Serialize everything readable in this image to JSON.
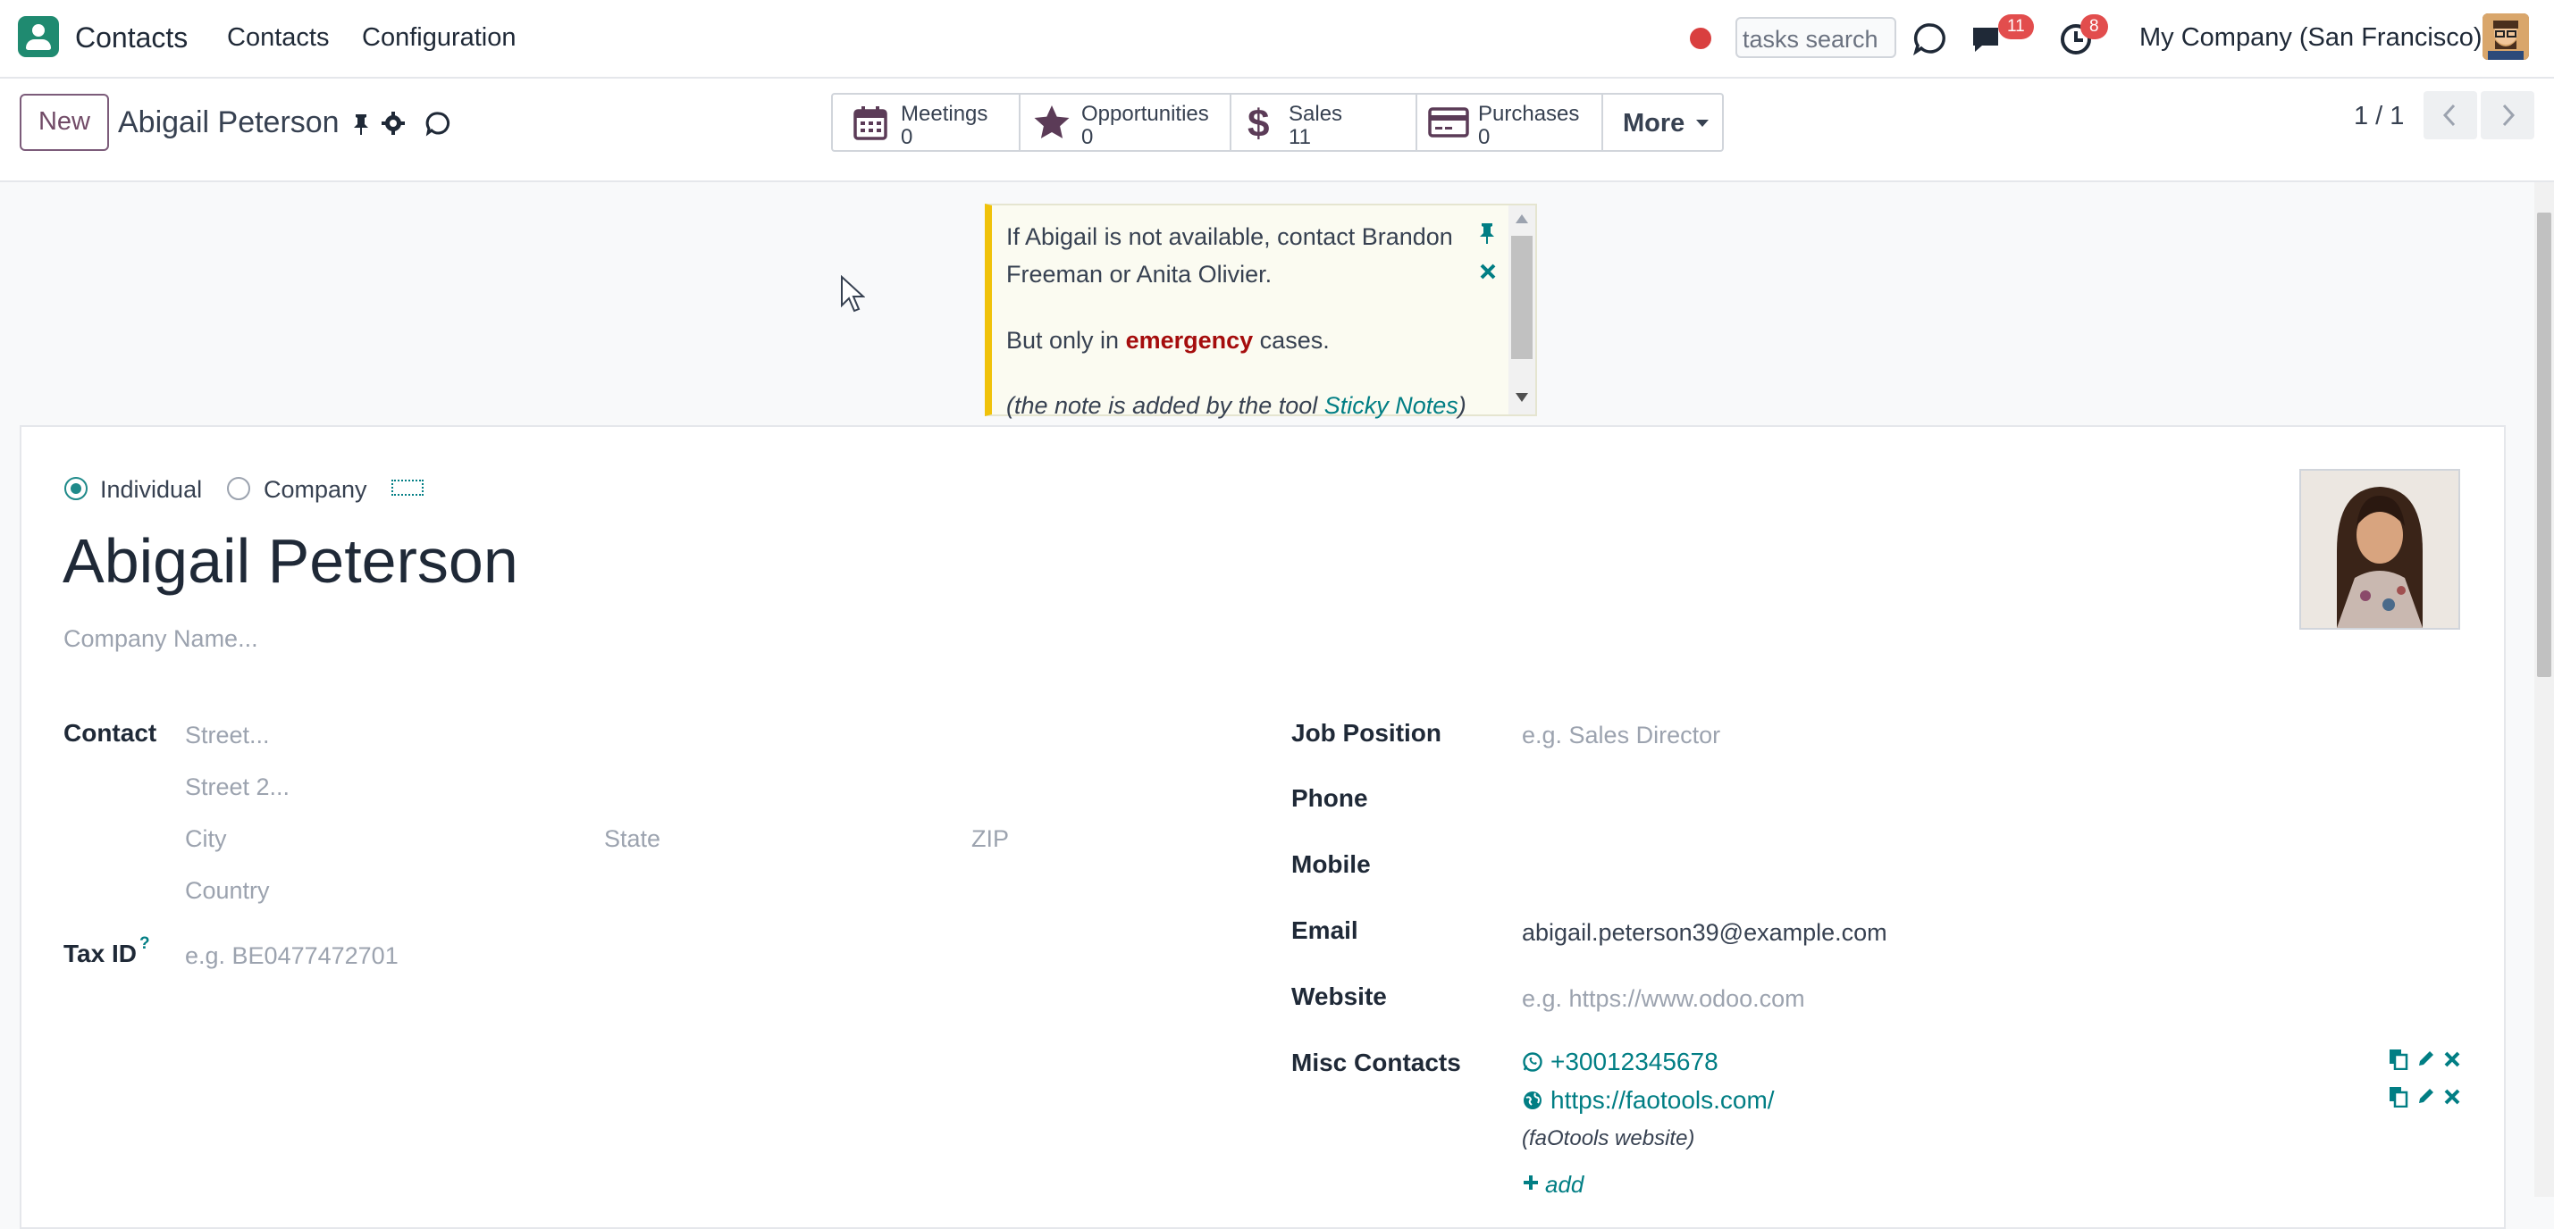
{
  "topnav": {
    "app_name": "Contacts",
    "menu": [
      "Contacts",
      "Configuration"
    ],
    "tasks_search_placeholder": "tasks search",
    "messages_badge": "11",
    "activities_badge": "8",
    "company": "My Company (San Francisco)"
  },
  "control_panel": {
    "new_label": "New",
    "record_name": "Abigail Peterson",
    "smart_buttons": [
      {
        "label": "Meetings",
        "value": "0",
        "icon": "calendar-icon"
      },
      {
        "label": "Opportunities",
        "value": "0",
        "icon": "star-icon"
      },
      {
        "label": "Sales",
        "value": "11",
        "icon": "dollar-icon"
      },
      {
        "label": "Purchases",
        "value": "0",
        "icon": "credit-card-icon"
      }
    ],
    "more_label": "More",
    "pager": "1 / 1"
  },
  "sticky_note": {
    "line1": "If Abigail is not available, contact Brandon",
    "line2": "Freeman or Anita Olivier.",
    "line3_prefix": "But only in ",
    "line3_emph": "emergency",
    "line3_suffix": " cases.",
    "line4_prefix": "(the note is added by the tool ",
    "line4_link": "Sticky Notes",
    "line4_suffix": ")"
  },
  "form": {
    "type_individual": "Individual",
    "type_company": "Company",
    "name": "Abigail Peterson",
    "company_placeholder": "Company Name...",
    "contact_label": "Contact",
    "street_placeholder": "Street...",
    "street2_placeholder": "Street 2...",
    "city_placeholder": "City",
    "state_placeholder": "State",
    "zip_placeholder": "ZIP",
    "country_placeholder": "Country",
    "taxid_label": "Tax ID",
    "taxid_help": "?",
    "taxid_placeholder": "e.g. BE0477472701",
    "job_label": "Job Position",
    "job_placeholder": "e.g. Sales Director",
    "phone_label": "Phone",
    "mobile_label": "Mobile",
    "email_label": "Email",
    "email_value": "abigail.peterson39@example.com",
    "website_label": "Website",
    "website_placeholder": "e.g. https://www.odoo.com",
    "misc_label": "Misc Contacts",
    "misc_items": [
      {
        "icon": "whatsapp-icon",
        "value": "+30012345678"
      },
      {
        "icon": "globe-icon",
        "value": "https://faotools.com/",
        "note": "(faOtools website)"
      }
    ],
    "add_label": "add"
  }
}
